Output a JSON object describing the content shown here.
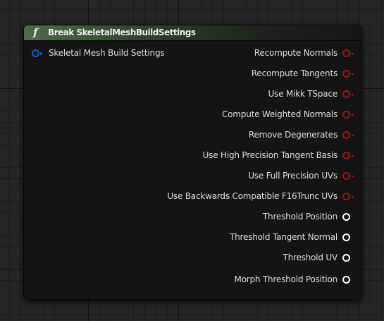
{
  "node": {
    "title": "Break SkeletalMeshBuildSettings",
    "function_icon_glyph": "f",
    "input": {
      "label": "Skeletal Mesh Build Settings",
      "icon": "struct-pin-icon",
      "color": "#0a62c6"
    },
    "outputs": [
      {
        "label": "Recompute Normals",
        "type": "bool",
        "color": "#9b1416"
      },
      {
        "label": "Recompute Tangents",
        "type": "bool",
        "color": "#9b1416"
      },
      {
        "label": "Use Mikk TSpace",
        "type": "bool",
        "color": "#9b1416"
      },
      {
        "label": "Compute Weighted Normals",
        "type": "bool",
        "color": "#9b1416"
      },
      {
        "label": "Remove Degenerates",
        "type": "bool",
        "color": "#9b1416"
      },
      {
        "label": "Use High Precision Tangent Basis",
        "type": "bool",
        "color": "#9b1416"
      },
      {
        "label": "Use Full Precision UVs",
        "type": "bool",
        "color": "#9b1416"
      },
      {
        "label": "Use Backwards Compatible F16Trunc UVs",
        "type": "bool",
        "color": "#9b1416"
      },
      {
        "label": "Threshold Position",
        "type": "float",
        "color": "#ffffff"
      },
      {
        "label": "Threshold Tangent Normal",
        "type": "float",
        "color": "#ffffff"
      },
      {
        "label": "Threshold UV",
        "type": "float",
        "color": "#ffffff"
      },
      {
        "label": "Morph Threshold Position",
        "type": "float",
        "color": "#ffffff"
      }
    ]
  }
}
